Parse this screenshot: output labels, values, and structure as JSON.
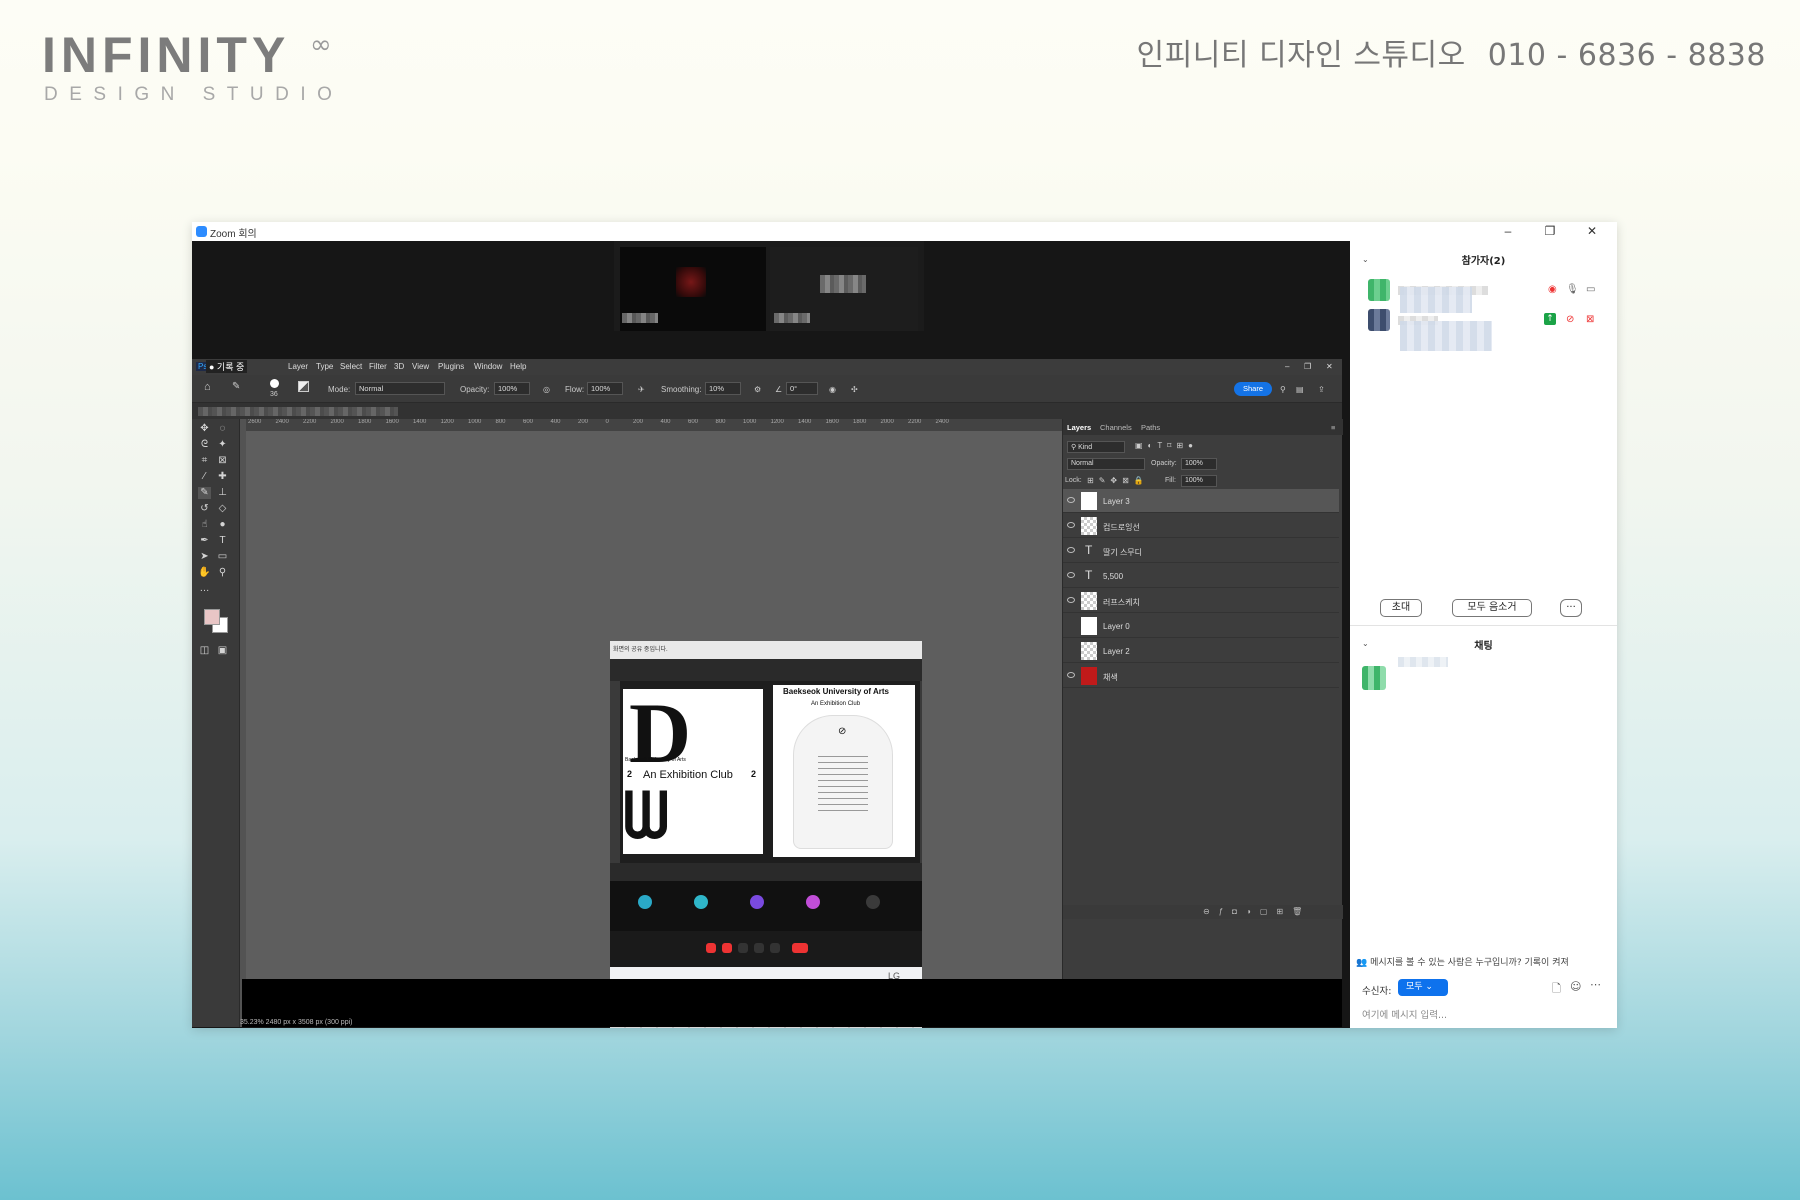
{
  "brand": {
    "name": "INFINITY",
    "mark": "∞",
    "subtitle": "DESIGN STUDIO"
  },
  "contact": {
    "studio": "인피니티 디자인 스튜디오",
    "phone": "010 - 6836 - 8838"
  },
  "zoom_window": {
    "title": "Zoom 회의",
    "controls": [
      "–",
      "❐",
      "✕"
    ]
  },
  "photoshop": {
    "recording": "● 기록 중",
    "menu": [
      "Layer",
      "Type",
      "Select",
      "Filter",
      "3D",
      "View",
      "Plugins",
      "Window",
      "Help"
    ],
    "options": {
      "brush_size": "36",
      "mode_label": "Mode:",
      "mode_value": "Normal",
      "opacity_label": "Opacity:",
      "opacity_value": "100%",
      "flow_label": "Flow:",
      "flow_value": "100%",
      "smoothing_label": "Smoothing:",
      "smoothing_value": "10%",
      "angle_value": "0°",
      "share": "Share"
    },
    "ruler": [
      "2600",
      "2400",
      "2200",
      "2000",
      "1800",
      "1600",
      "1400",
      "1200",
      "1000",
      "800",
      "600",
      "400",
      "200",
      "0",
      "200",
      "400",
      "600",
      "800",
      "1000",
      "1200",
      "1400",
      "1600",
      "1800",
      "2000",
      "2200",
      "2400"
    ],
    "status": "35.23%    2480 px x 3508 px (300 ppi)",
    "colors": {
      "foreground": "#e9c6c6",
      "background": "#ffffff"
    },
    "layers_panel": {
      "tabs": [
        "Layers",
        "Channels",
        "Paths"
      ],
      "filter_kind": "Kind",
      "blend_mode": "Normal",
      "opacity_label": "Opacity:",
      "opacity_value": "100%",
      "lock_label": "Lock:",
      "fill_label": "Fill:",
      "fill_value": "100%",
      "layers": [
        {
          "name": "Layer 3",
          "selected": true,
          "visible": true,
          "kind": "raster"
        },
        {
          "name": "컵드로잉선",
          "visible": true,
          "kind": "raster"
        },
        {
          "name": "딸기 스무디",
          "visible": true,
          "kind": "text"
        },
        {
          "name": "5,500",
          "visible": true,
          "kind": "text"
        },
        {
          "name": "러프스케치",
          "visible": true,
          "kind": "raster"
        },
        {
          "name": "Layer 0",
          "visible": false,
          "kind": "white"
        },
        {
          "name": "Layer 2",
          "visible": false,
          "kind": "raster"
        },
        {
          "name": "채색",
          "visible": true,
          "kind": "red"
        }
      ]
    },
    "document": {
      "top_bar": "화면의 공유 중입니다.",
      "univ": "Baekseok University of Arts",
      "club": "An Exhibition Club",
      "club_left": "An Exhibition Club",
      "number": "2",
      "brand_tv": "LG"
    }
  },
  "sidebar": {
    "participants_title": "참가자(2)",
    "buttons": {
      "invite": "초대",
      "mute_all": "모두 음소거",
      "more": "···"
    },
    "chat_title": "채팅",
    "notice": "메시지를 볼 수 있는 사람은 누구입니까? 기록이 켜져",
    "recipient_label": "수신자:",
    "recipient_value": "모두",
    "input_placeholder": "여기에 메시지 입력..."
  }
}
